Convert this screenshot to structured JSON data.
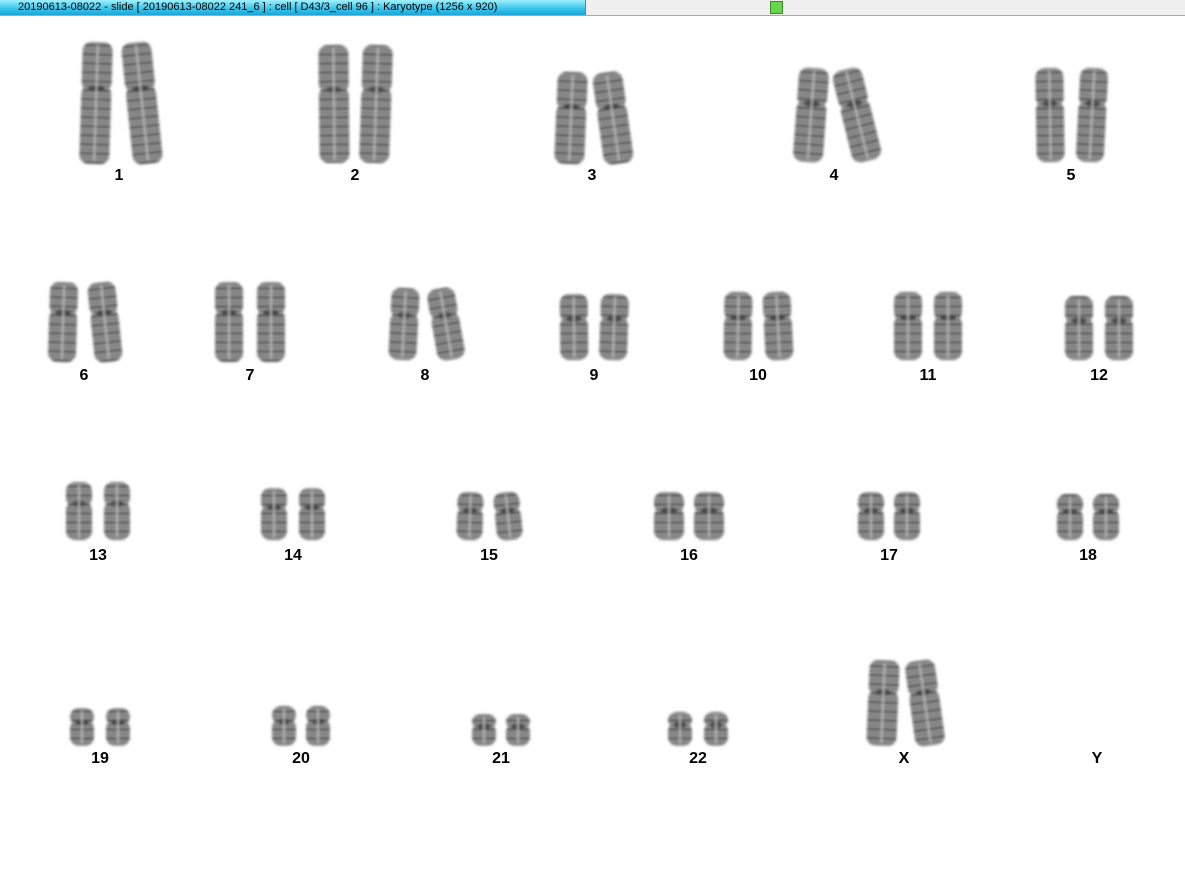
{
  "window": {
    "title": "20190613-08022 - slide [ 20190613-08022 241_6 ] : cell [ D43/3_cell 96 ] : Karyotype  (1256 x 920)",
    "status_color": "#66d64a",
    "title_color": "#3cc8ec"
  },
  "karyotype": {
    "chromosomes": [
      {
        "label": "1"
      },
      {
        "label": "2"
      },
      {
        "label": "3"
      },
      {
        "label": "4"
      },
      {
        "label": "5"
      },
      {
        "label": "6"
      },
      {
        "label": "7"
      },
      {
        "label": "8"
      },
      {
        "label": "9"
      },
      {
        "label": "10"
      },
      {
        "label": "11"
      },
      {
        "label": "12"
      },
      {
        "label": "13"
      },
      {
        "label": "14"
      },
      {
        "label": "15"
      },
      {
        "label": "16"
      },
      {
        "label": "17"
      },
      {
        "label": "18"
      },
      {
        "label": "19"
      },
      {
        "label": "20"
      },
      {
        "label": "21"
      },
      {
        "label": "22"
      },
      {
        "label": "X"
      },
      {
        "label": "Y"
      }
    ]
  }
}
